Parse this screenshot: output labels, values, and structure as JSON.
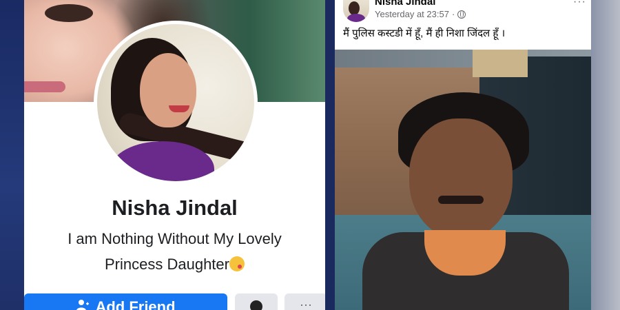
{
  "profile": {
    "name": "Nisha Jindal",
    "bio_line1": "I am Nothing Without My Lovely",
    "bio_line2": "Princess Daughter",
    "add_friend_label": "Add Friend",
    "add_friend_icon": "person-plus-icon",
    "messenger_icon": "messenger-icon",
    "more_label": "···"
  },
  "post": {
    "author": "Nisha Jindal",
    "timestamp": "Yesterday at 23:57",
    "separator": "·",
    "privacy_icon": "globe-icon",
    "menu_label": "···",
    "text": "मैं पुलिस कस्टडी में हूँ, मैं ही निशा जिंदल हूँ ।"
  },
  "colors": {
    "facebook_blue": "#1877f2",
    "secondary_button": "#e4e6eb",
    "text_primary": "#1c1e21",
    "text_secondary": "#65676b",
    "background_navy": "#1d2c5c"
  }
}
